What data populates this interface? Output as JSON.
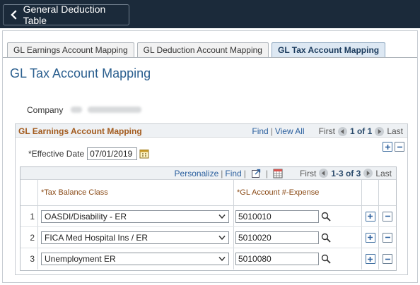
{
  "header": {
    "back_label": "General Deduction Table"
  },
  "tabs": [
    {
      "label": "GL Earnings Account Mapping",
      "active": false
    },
    {
      "label": "GL Deduction Account Mapping",
      "active": false
    },
    {
      "label": "GL Tax Account Mapping",
      "active": true
    }
  ],
  "page_title": "GL Tax Account Mapping",
  "company": {
    "label": "Company"
  },
  "group": {
    "title": "GL Earnings Account Mapping",
    "find": "Find",
    "view_all": "View All",
    "first": "First",
    "range": "1 of 1",
    "last": "Last"
  },
  "effective_date": {
    "label": "*Effective Date",
    "value": "07/01/2019"
  },
  "grid": {
    "personalize": "Personalize",
    "find": "Find",
    "first": "First",
    "range": "1-3 of 3",
    "last": "Last",
    "columns": {
      "tax_balance_class": "*Tax Balance Class",
      "gl_account": "*GL Account #-Expense"
    },
    "rows": [
      {
        "num": "1",
        "class": "OASDI/Disability - ER",
        "account": "5010010"
      },
      {
        "num": "2",
        "class": "FICA Med Hospital Ins / ER",
        "account": "5010020"
      },
      {
        "num": "3",
        "class": "Unemployment ER",
        "account": "5010080"
      }
    ]
  },
  "colors": {
    "header_bg": "#1b2a3a",
    "title_blue": "#2b5f8f",
    "group_title": "#a35b1e",
    "link": "#2a5f9e"
  }
}
